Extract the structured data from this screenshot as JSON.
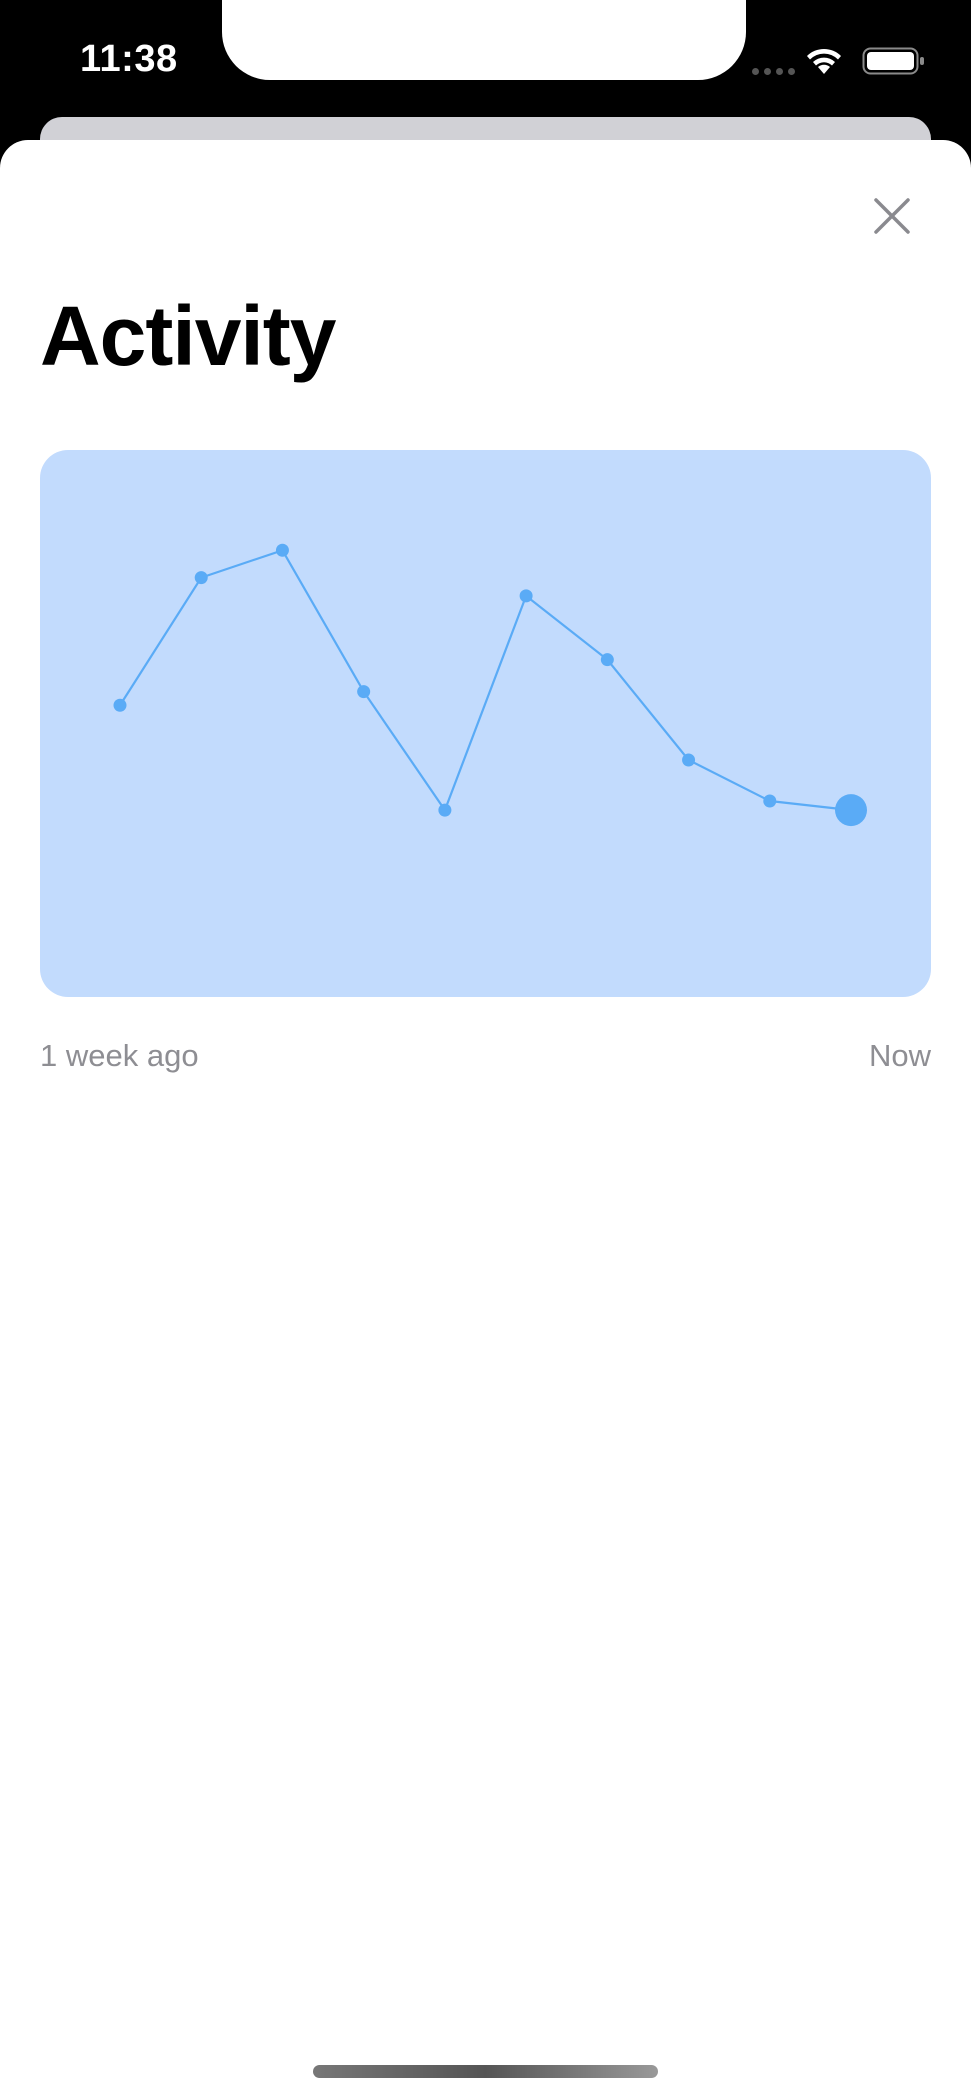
{
  "status_bar": {
    "time": "11:38",
    "icons": [
      "cellular-signal-icon",
      "wifi-icon",
      "battery-icon"
    ]
  },
  "sheet": {
    "title": "Activity",
    "close_icon": "close-icon"
  },
  "range": {
    "start_label": "1 week ago",
    "end_label": "Now"
  },
  "colors": {
    "chart_background": "#c2dbfd",
    "line": "#5aabf6",
    "secondary_text": "#8e8e93"
  },
  "chart_data": {
    "type": "line",
    "title": "",
    "xlabel": "",
    "ylabel": "",
    "x_labels": [
      "1 week ago",
      "Now"
    ],
    "series": [
      {
        "values": [
          64,
          92,
          98,
          67,
          41,
          88,
          74,
          52,
          43,
          41
        ]
      }
    ],
    "ylim": [
      0,
      120
    ],
    "grid": false,
    "highlight_last_point": true
  }
}
